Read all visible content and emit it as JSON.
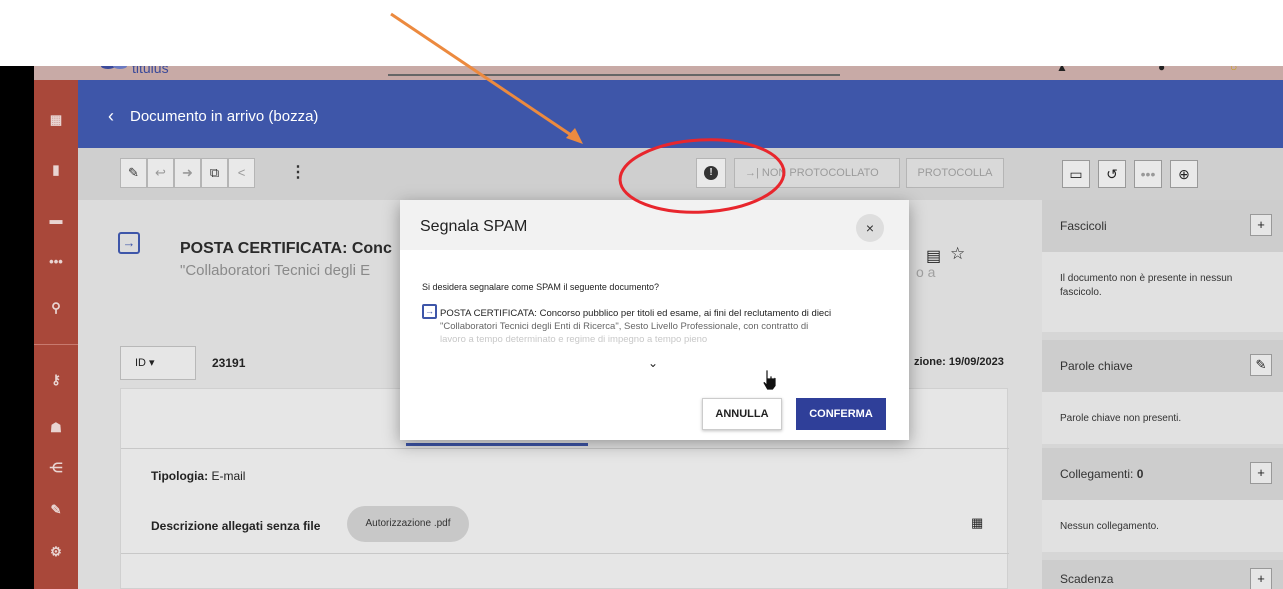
{
  "app": {
    "logo_text": "titulus"
  },
  "header": {
    "back_icon": "chevron-left-icon",
    "title": "Documento in arrivo (bozza)"
  },
  "toolbar": {
    "non_protocollato": "→| NON PROTOCOLLATO",
    "protocolla": "PROTOCOLLA",
    "spam_icon": "exclamation-circle-icon"
  },
  "document": {
    "title": "POSTA CERTIFICATA: Conc",
    "subtitle": "\"Collaboratori Tecnici degli E",
    "subtitle_tail": "o a",
    "id_label": "ID ▾",
    "id_value": "23191",
    "date_label": "zione: 19/09/2023",
    "tipologia_label": "Tipologia:",
    "tipologia_value": "E-mail",
    "descr_label": "Descrizione allegati senza file",
    "attachment": "Autorizzazione .pdf"
  },
  "right_panel": {
    "fascicoli_label": "Fascicoli",
    "fascicoli_text": "Il documento non è presente in nessun fascicolo.",
    "parole_label": "Parole chiave",
    "parole_text": "Parole chiave non presenti.",
    "collegamenti_label": "Collegamenti:",
    "collegamenti_count": "0",
    "collegamenti_text": "Nessun collegamento.",
    "scadenza_label": "Scadenza"
  },
  "dialog": {
    "title": "Segnala SPAM",
    "close": "×",
    "question": "Si desidera segnalare come SPAM il seguente documento?",
    "doc_line1": "POSTA CERTIFICATA: Concorso pubblico per titoli ed esame, ai fini del reclutamento di dieci",
    "doc_line2": "\"Collaboratori Tecnici degli Enti di Ricerca\", Sesto Livello Professionale, con contratto di",
    "doc_line3": "lavoro a tempo determinato e regime di impegno a tempo pieno",
    "cancel_label": "ANNULLA",
    "confirm_label": "CONFERMA",
    "accent": "#2f3f99"
  },
  "colors": {
    "sidebar": "#a9483a",
    "header": "#3e56a9",
    "arrow": "#ec8a3f",
    "circle": "#e8262d"
  }
}
